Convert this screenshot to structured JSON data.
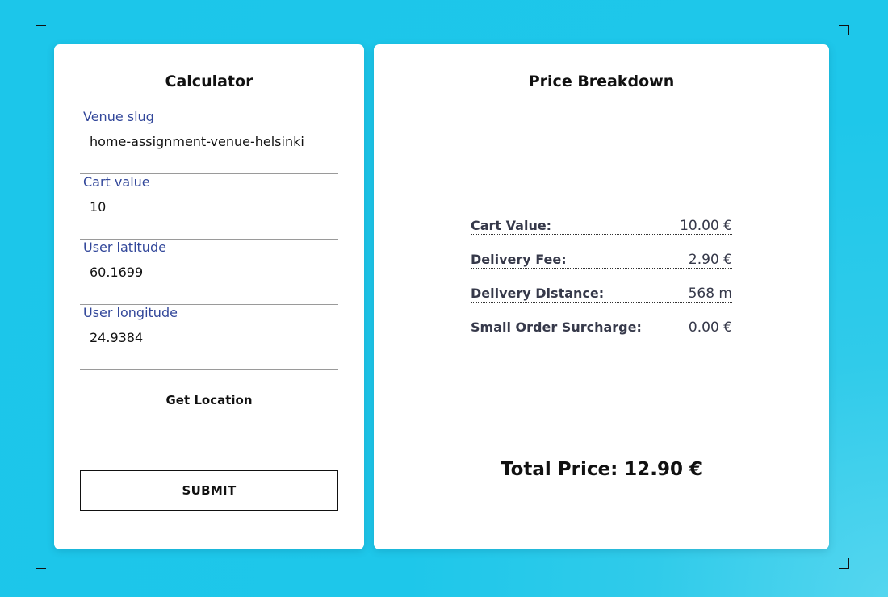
{
  "colors": {
    "background": "#1cc6ea",
    "card": "#ffffff",
    "label_blue": "#32479a",
    "text_dark": "#111111",
    "breakdown_text": "#36394a"
  },
  "calculator": {
    "title": "Calculator",
    "fields": [
      {
        "label": "Venue slug",
        "value": "home-assignment-venue-helsinki"
      },
      {
        "label": "Cart value",
        "value": "10"
      },
      {
        "label": "User latitude",
        "value": "60.1699"
      },
      {
        "label": "User longitude",
        "value": "24.9384"
      }
    ],
    "get_location_label": "Get Location",
    "submit_label": "SUBMIT"
  },
  "breakdown": {
    "title": "Price Breakdown",
    "rows": [
      {
        "label": "Cart Value:",
        "value": "10.00 €"
      },
      {
        "label": "Delivery Fee:",
        "value": "2.90 €"
      },
      {
        "label": "Delivery Distance:",
        "value": "568 m"
      },
      {
        "label": "Small Order Surcharge:",
        "value": "0.00 €"
      }
    ],
    "total": "Total Price: 12.90 €"
  }
}
